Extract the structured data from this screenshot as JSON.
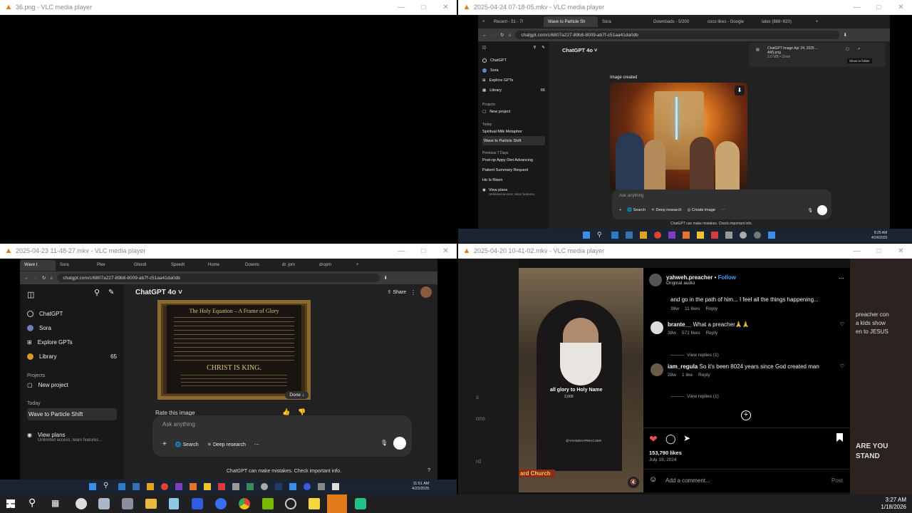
{
  "win1": {
    "title": "36.png - VLC media player"
  },
  "win2": {
    "title": "2025-04-24 07-18-05.mkv - VLC media player",
    "tabs": [
      "Recent - 51 - 7/",
      "Wave to Particle Sh",
      "Sora",
      "Downloads - 5/200",
      "coco likes - Google",
      "latex (888~920)"
    ],
    "url": "chatgpt.com/c/6807a227-89b8-8009-ab7f-c51aa41da0db",
    "model": "ChatGPT 4o",
    "sidebar": [
      "ChatGPT",
      "Sora",
      "Explore GPTs",
      "Library"
    ],
    "library_count": "66",
    "projects_header": "Projects",
    "new_project": "New project",
    "today": "Today",
    "today_items": [
      "Spiritual Milk Metaphor",
      "Wave to Particle Shift"
    ],
    "prev_header": "Previous 7 Days",
    "prev_items": [
      "Post-op Appy Diet Advancing",
      "Patient Summary Request",
      "He Is Risen"
    ],
    "view_plans": "View plans",
    "view_plans_sub": "Unlimited access, team features...",
    "image_created": "Image created",
    "download_name": "ChatGPT Image Apr 24, 2025 ...",
    "download_name2": "AM).png",
    "download_meta": "2.0 MB • Done",
    "show_in_folder": "Show in folder",
    "ask": "Ask anything",
    "btn_search": "Search",
    "btn_deep": "Deep research",
    "btn_create": "Create image",
    "disclaimer": "ChatGPT can make mistakes. Check important info.",
    "time": "8:25 AM",
    "date": "4/24/2025"
  },
  "win3": {
    "title": "2025-04-23 11-48-27.mkv - VLC media player",
    "tabs": [
      "Wave t",
      "Sora",
      "Plex",
      "Ghostl",
      "Speedt",
      "Home",
      "Downlo",
      "dr. jom",
      "dropm"
    ],
    "url": "chatgpt.com/c/6807a227-89b8-8009-ab7f-c51aa41da0db",
    "model": "ChatGPT 4o",
    "share": "Share",
    "sidebar": [
      "ChatGPT",
      "Sora",
      "Explore GPTs",
      "Library"
    ],
    "library_count": "65",
    "projects_header": "Projects",
    "new_project": "New project",
    "today": "Today",
    "today_item": "Wave to Particle Shift",
    "view_plans": "View plans",
    "view_plans_sub": "Unlimited access, team features...",
    "poster_title": "The Holy Equation – A Frame of Glory",
    "poster_king": "CHRIST IS KING.",
    "done": "Done",
    "rate": "Rate this image",
    "ask": "Ask anything",
    "btn_search": "Search",
    "btn_deep": "Deep research",
    "disclaimer": "ChatGPT can make mistakes. Check important info.",
    "time": "11:51 AM",
    "date": "4/23/2025"
  },
  "win4": {
    "title": "2025-04-20 10-41-02.mkv - VLC media player",
    "username": "yahweh.preacher",
    "follow": "Follow",
    "audio": "Original audio",
    "caption_tail": "and go in the path of him... I feel all the things happening...",
    "caption_meta": "38w",
    "caption_likes": "11 likes",
    "reply": "Reply",
    "c1_user": "brante__",
    "c1_text": "What a preacher🙏🙏",
    "c1_time": "38w",
    "c1_likes": "572 likes",
    "c1_replies": "View replies (1)",
    "c2_user": "iam_regula",
    "c2_text": "So it's been 8024 years since God created man",
    "c2_time": "28w",
    "c2_likes": "1 like",
    "c2_replies": "View replies (1)",
    "likes": "153,790 likes",
    "date": "July 19, 2024",
    "add_comment": "Add a comment...",
    "post": "Post",
    "video_caption": "all glory to Holy Name",
    "video_sub": "2,000",
    "watermark": "@YAHWEH.PREACHER",
    "church": "ard Church",
    "side_text_1": "s",
    "side_text_2": "ons",
    "side_text_3": "rd",
    "bg_right_1": "preacher con",
    "bg_right_2": "a kids show",
    "bg_right_3": "en to JESUS",
    "bg_right_4": "ARE YOU",
    "bg_right_5": "STAND"
  },
  "taskbar": {
    "time": "3:27 AM",
    "date": "1/18/2026"
  }
}
